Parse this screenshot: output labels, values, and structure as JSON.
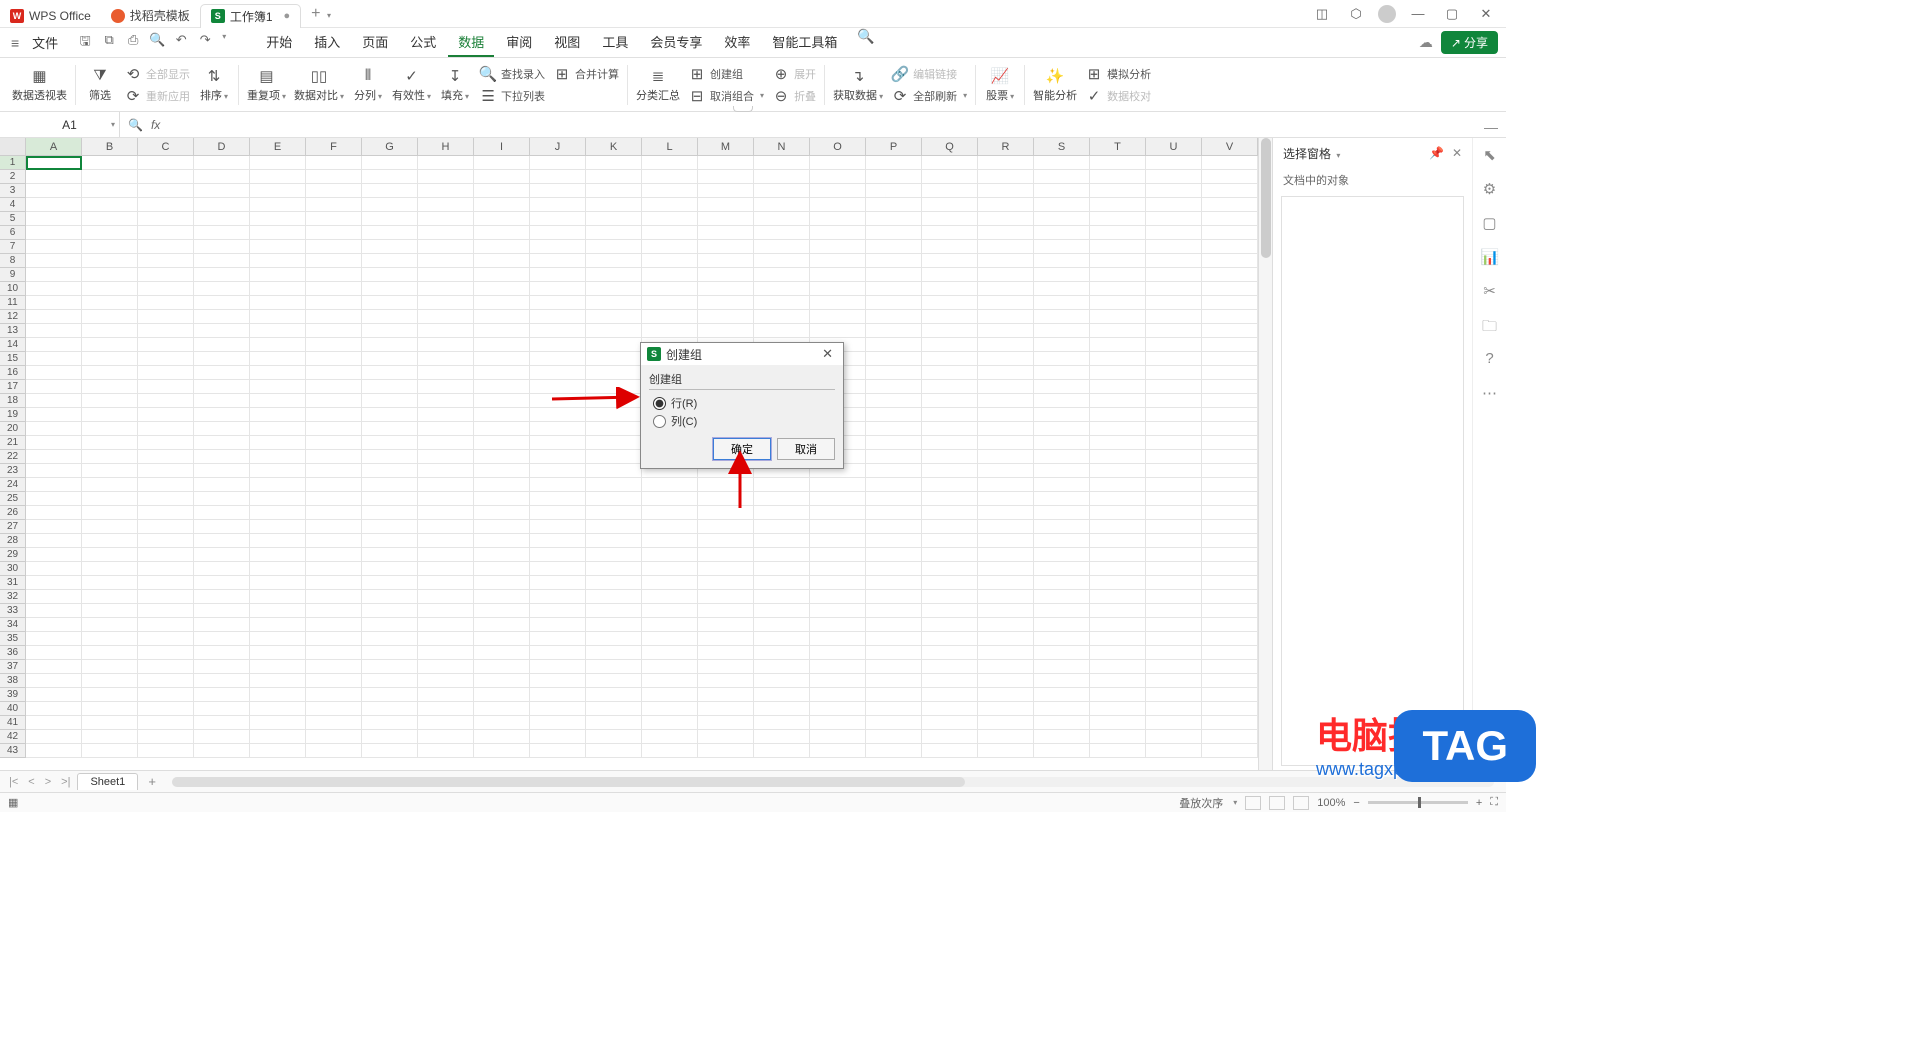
{
  "titlebar": {
    "app_tab": "WPS Office",
    "template_tab": "找稻壳模板",
    "doc_tab": "工作簿1",
    "add": "+"
  },
  "menubar": {
    "file": "文件",
    "tabs": [
      "开始",
      "插入",
      "页面",
      "公式",
      "数据",
      "审阅",
      "视图",
      "工具",
      "会员专享",
      "效率",
      "智能工具箱"
    ],
    "active_index": 4,
    "share": "分享"
  },
  "ribbon": {
    "pivot": "数据透视表",
    "filter": "筛选",
    "show_all": "全部显示",
    "reapply": "重新应用",
    "sort": "排序",
    "dup": "重复项",
    "compare": "数据对比",
    "split": "分列",
    "validity": "有效性",
    "fill": "填充",
    "lookup": "查找录入",
    "consolidate": "合并计算",
    "dropdown": "下拉列表",
    "subtotal": "分类汇总",
    "group": "创建组",
    "ungroup": "取消组合",
    "expand": "展开",
    "collapse": "折叠",
    "editlinks": "编辑链接",
    "getdata": "获取数据",
    "refresh": "全部刷新",
    "stocks": "股票",
    "smart": "智能分析",
    "whatif": "模拟分析",
    "datacheck": "数据校对"
  },
  "namebox": {
    "value": "A1"
  },
  "formula": {
    "fx": "fx"
  },
  "columns": [
    "A",
    "B",
    "C",
    "D",
    "E",
    "F",
    "G",
    "H",
    "I",
    "J",
    "K",
    "L",
    "M",
    "N",
    "O",
    "P",
    "Q",
    "R",
    "S",
    "T",
    "U",
    "V"
  ],
  "rows": 43,
  "taskpane": {
    "title": "选择窗格",
    "subtitle": "文档中的对象"
  },
  "sheettab": {
    "name": "Sheet1"
  },
  "statusbar": {
    "order": "叠放次序",
    "zoom": "100%"
  },
  "dialog": {
    "title": "创建组",
    "group_label": "创建组",
    "row_opt": "行(R)",
    "col_opt": "列(C)",
    "ok": "确定",
    "cancel": "取消"
  },
  "watermark": {
    "line1": "电脑技术网",
    "line2": "www.tagxp.com",
    "tag": "TAG"
  }
}
